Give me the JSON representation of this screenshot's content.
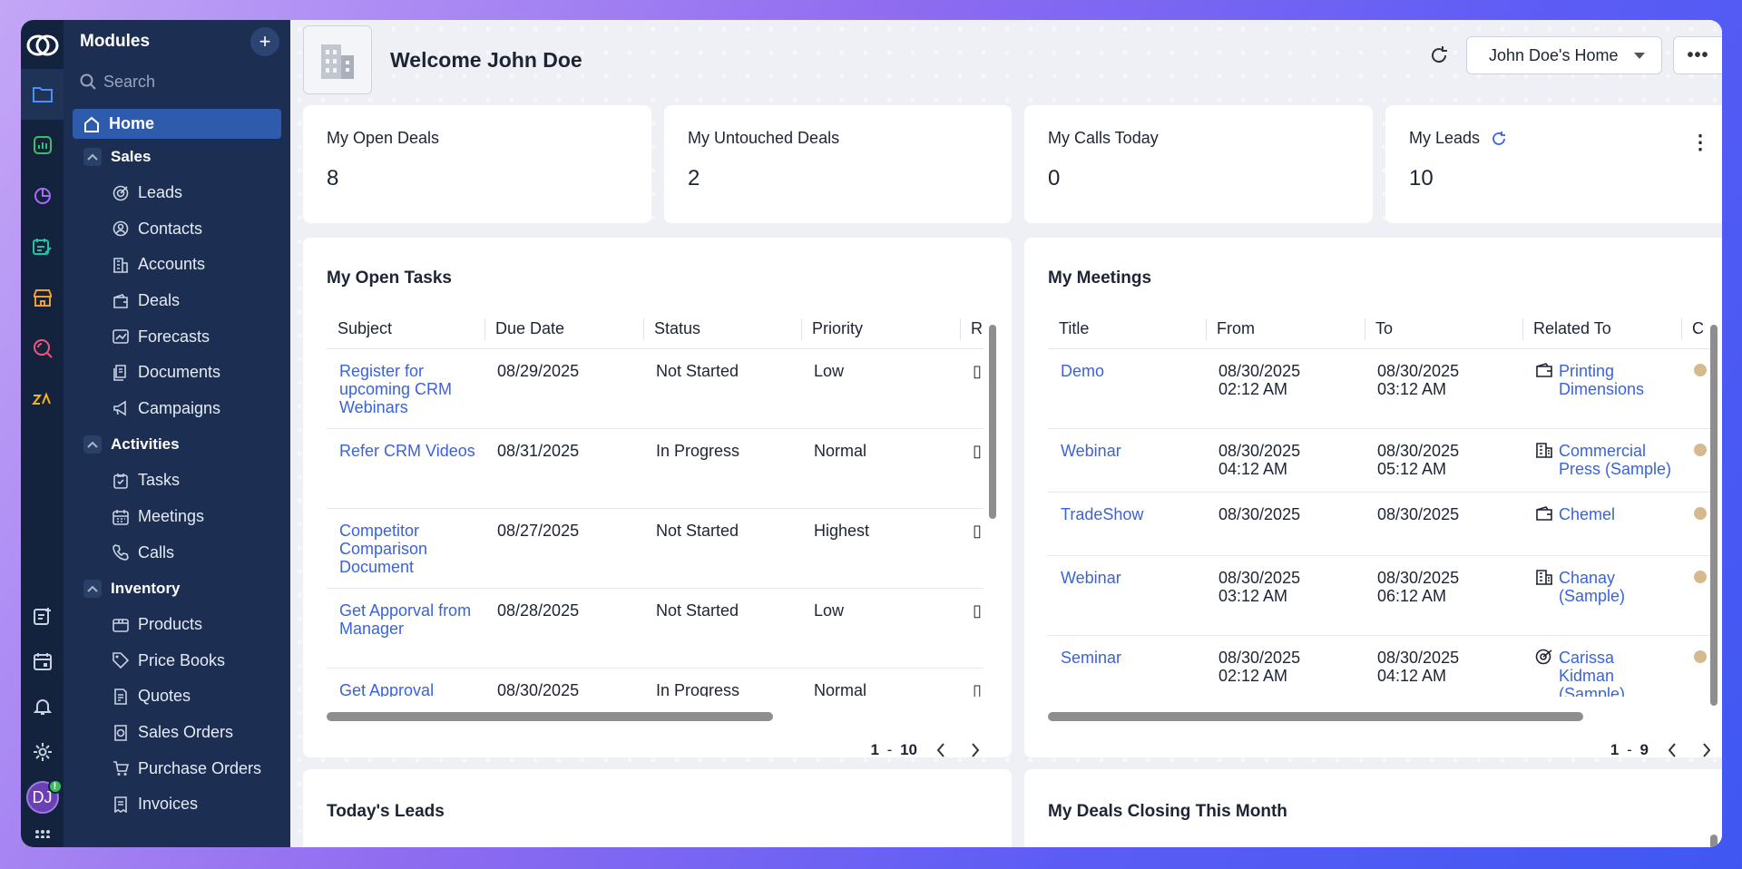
{
  "modules_panel": {
    "title": "Modules",
    "search_placeholder": "Search",
    "home": "Home",
    "groups": [
      {
        "label": "Sales",
        "items": [
          "Leads",
          "Contacts",
          "Accounts",
          "Deals",
          "Forecasts",
          "Documents",
          "Campaigns"
        ]
      },
      {
        "label": "Activities",
        "items": [
          "Tasks",
          "Meetings",
          "Calls"
        ]
      },
      {
        "label": "Inventory",
        "items": [
          "Products",
          "Price Books",
          "Quotes",
          "Sales Orders",
          "Purchase Orders",
          "Invoices"
        ]
      }
    ]
  },
  "user": {
    "initials": "DJ",
    "badge": "!"
  },
  "header": {
    "welcome": "Welcome John Doe",
    "home_select": "John Doe's Home",
    "more": "•••"
  },
  "kpis": [
    {
      "label": "My Open Deals",
      "value": "8"
    },
    {
      "label": "My Untouched Deals",
      "value": "2"
    },
    {
      "label": "My Calls Today",
      "value": "0"
    },
    {
      "label": "My Leads",
      "value": "10"
    }
  ],
  "open_tasks": {
    "title": "My Open Tasks",
    "columns": [
      "Subject",
      "Due Date",
      "Status",
      "Priority",
      "R"
    ],
    "rows": [
      {
        "subject": "Register for upcoming CRM Webinars",
        "due": "08/29/2025",
        "status": "Not Started",
        "priority": "Low"
      },
      {
        "subject": "Refer CRM Videos",
        "due": "08/31/2025",
        "status": "In Progress",
        "priority": "Normal"
      },
      {
        "subject": "Competitor Comparison Document",
        "due": "08/27/2025",
        "status": "Not Started",
        "priority": "Highest"
      },
      {
        "subject": "Get Apporval from Manager",
        "due": "08/28/2025",
        "status": "Not Started",
        "priority": "Low"
      },
      {
        "subject": "Get Approval",
        "due": "08/30/2025",
        "status": "In Progress",
        "priority": "Normal"
      }
    ],
    "pager": {
      "start": "1",
      "sep": "-",
      "end": "10"
    }
  },
  "meetings": {
    "title": "My Meetings",
    "columns": [
      "Title",
      "From",
      "To",
      "Related To",
      "C"
    ],
    "rows": [
      {
        "title": "Demo",
        "from": "08/30/2025\n02:12 AM",
        "to": "08/30/2025\n03:12 AM",
        "related": "Printing Dimensions",
        "icon": "wallet"
      },
      {
        "title": "Webinar",
        "from": "08/30/2025\n04:12 AM",
        "to": "08/30/2025\n05:12 AM",
        "related": "Commercial Press (Sample)",
        "icon": "building"
      },
      {
        "title": "TradeShow",
        "from": "08/30/2025",
        "to": "08/30/2025",
        "related": "Chemel",
        "icon": "wallet"
      },
      {
        "title": "Webinar",
        "from": "08/30/2025\n03:12 AM",
        "to": "08/30/2025\n06:12 AM",
        "related": "Chanay (Sample)",
        "icon": "building"
      },
      {
        "title": "Seminar",
        "from": "08/30/2025\n02:12 AM",
        "to": "08/30/2025\n04:12 AM",
        "related": "Carissa Kidman (Sample)",
        "icon": "target"
      }
    ],
    "pager": {
      "start": "1",
      "sep": "-",
      "end": "9"
    }
  },
  "todays_leads": {
    "title": "Today's Leads"
  },
  "deals_closing": {
    "title": "My Deals Closing This Month"
  }
}
